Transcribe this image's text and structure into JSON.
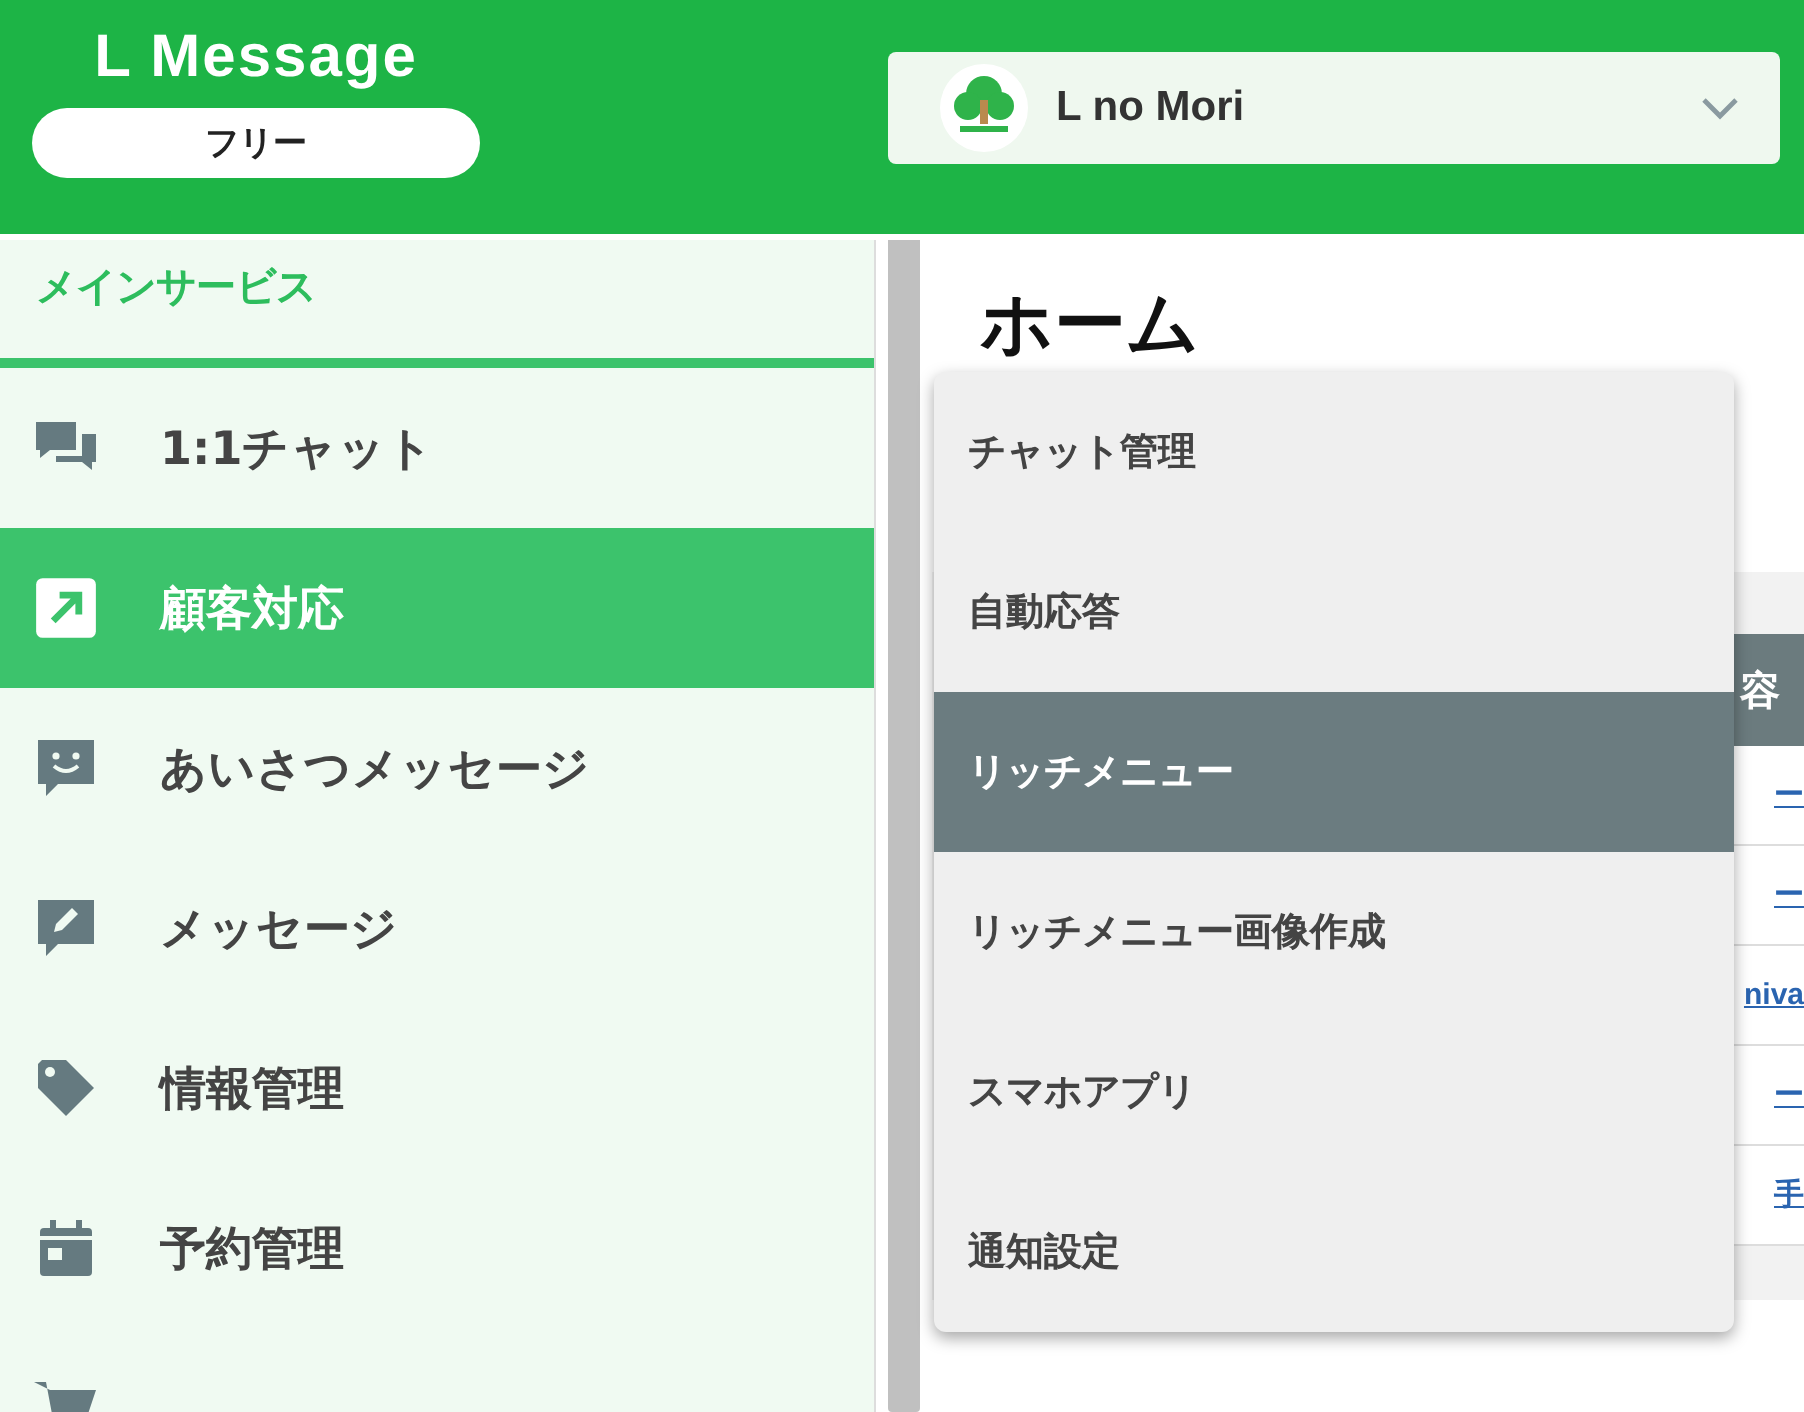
{
  "header": {
    "logo": "L Message",
    "plan": "フリー",
    "account": {
      "name": "L no Mori"
    }
  },
  "sidebar": {
    "section": "メインサービス",
    "items": [
      {
        "label": "1:1チャット",
        "selected": false
      },
      {
        "label": "顧客対応",
        "selected": true
      },
      {
        "label": "あいさつメッセージ",
        "selected": false
      },
      {
        "label": "メッセージ",
        "selected": false
      },
      {
        "label": "情報管理",
        "selected": false
      },
      {
        "label": "予約管理",
        "selected": false
      },
      {
        "selected": false
      }
    ]
  },
  "main": {
    "title": "ホーム",
    "table": {
      "header": "容",
      "rows": [
        "ー",
        "ー",
        "niva",
        "ー",
        "手"
      ]
    }
  },
  "dropdown": {
    "items": [
      {
        "label": "チャット管理",
        "selected": false
      },
      {
        "label": "自動応答",
        "selected": false
      },
      {
        "label": "リッチメニュー",
        "selected": true
      },
      {
        "label": "リッチメニュー画像作成",
        "selected": false
      },
      {
        "label": "スマホアプリ",
        "selected": false
      },
      {
        "label": "通知設定",
        "selected": false
      }
    ]
  }
}
